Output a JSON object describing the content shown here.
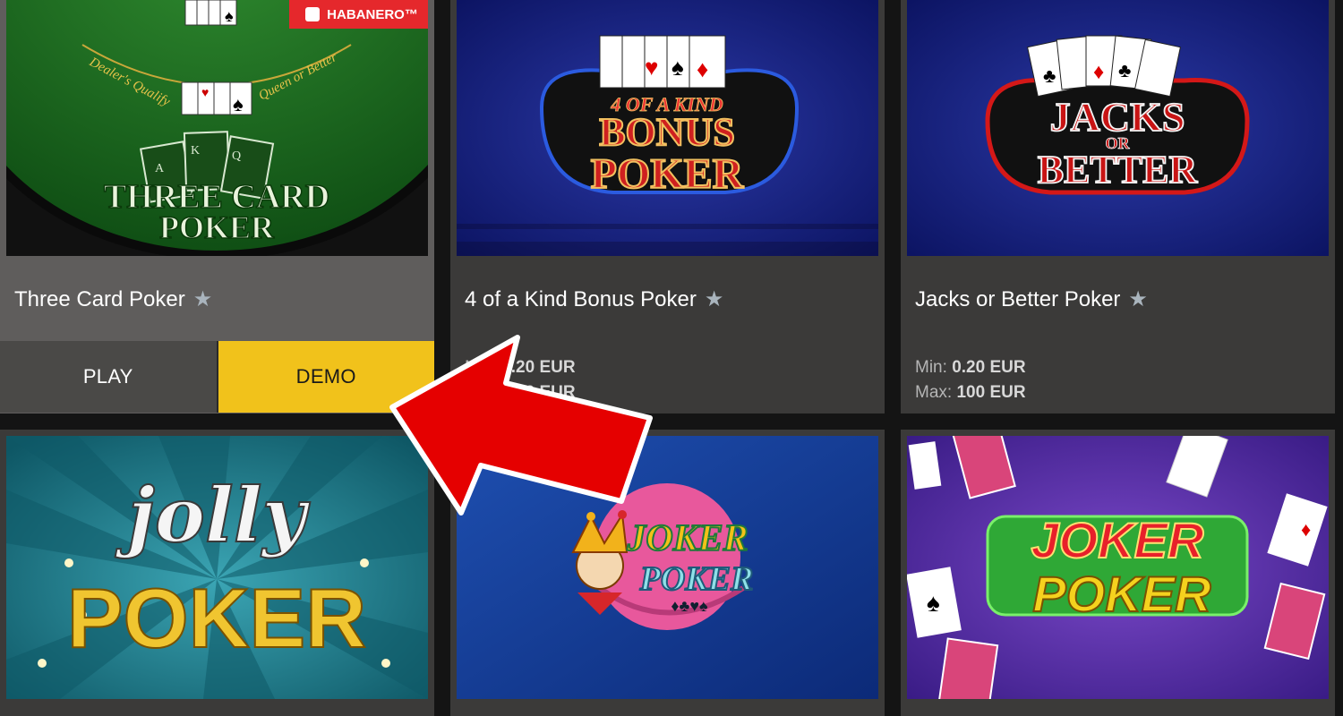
{
  "games": [
    {
      "title": "Three Card Poker",
      "art": {
        "line1": "THREE CARD",
        "line2": "POKER",
        "arc_left": "Dealer's Qualify",
        "arc_right": "Queen or Better",
        "cards": [
          "A",
          "K",
          "Q"
        ]
      },
      "provider_badge": "HABANERO™",
      "actions": {
        "play": "PLAY",
        "demo": "DEMO"
      }
    },
    {
      "title": "4 of a Kind Bonus Poker",
      "art": {
        "line0": "4 OF A KIND",
        "line1": "BONUS",
        "line2": "POKER"
      },
      "min_label": "Min:",
      "min_value": "0.20 EUR",
      "max_label": "Max:",
      "max_value": "100 EUR"
    },
    {
      "title": "Jacks or Better Poker",
      "art": {
        "line1": "JACKS",
        "line_or": "OR",
        "line2": "BETTER"
      },
      "min_label": "Min:",
      "min_value": "0.20 EUR",
      "max_label": "Max:",
      "max_value": "100 EUR"
    },
    {
      "art": {
        "line1": "jolly",
        "line2": "POKER"
      }
    },
    {
      "art": {
        "line1": "JOKER",
        "line2": "POKER"
      }
    },
    {
      "art": {
        "line1": "JOKER",
        "line2": "POKER"
      }
    }
  ],
  "icons": {
    "favorite": "star-icon",
    "overlay": "red-arrow-annotation"
  },
  "colors": {
    "page_bg": "#141414",
    "card_bg": "#3b3a39",
    "demo_button": "#f1c21b",
    "play_button": "#4a4947",
    "arrow": "#e50000",
    "badge": "#e5282c"
  }
}
